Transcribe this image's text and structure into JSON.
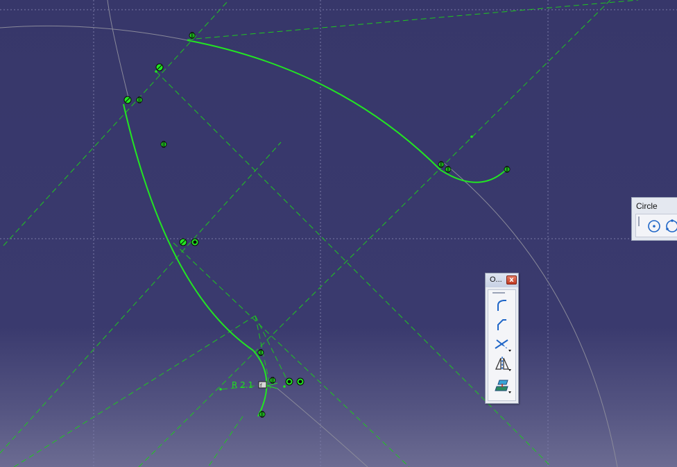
{
  "sketch": {
    "dimension_label": "R 2.1",
    "colors": {
      "background_top": "#37376a",
      "background_bottom": "#6c6c92",
      "geometry": "#22e622",
      "construction": "#1ec81e",
      "grid": "#7a7aa6",
      "reference": "#808090"
    }
  },
  "operation_toolbar": {
    "title": "O...",
    "close_glyph": "x",
    "tools": [
      {
        "icon": "corner-icon"
      },
      {
        "icon": "chamfer-icon"
      },
      {
        "icon": "trim-icon"
      },
      {
        "icon": "mirror-icon"
      },
      {
        "icon": "project-3d-elements-icon"
      }
    ]
  },
  "circle_toolbar": {
    "title": "Circle",
    "tools": [
      {
        "icon": "circle-icon"
      },
      {
        "icon": "three-point-circle-icon"
      }
    ]
  }
}
